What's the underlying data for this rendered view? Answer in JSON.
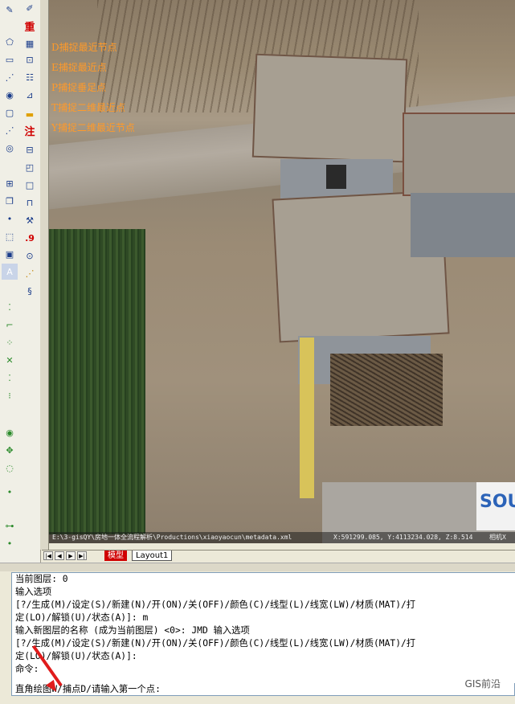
{
  "toolbar_left": {
    "icons": [
      "edit-icon",
      "polygon-icon",
      "rectangle-icon",
      "dots-icon",
      "circle-icon",
      "rounded-rect-icon",
      "dots-icon",
      "eye-icon",
      "grid-icon",
      "layers-icon",
      "dot-icon",
      "select-icon",
      "frame-icon"
    ],
    "label_a": "A"
  },
  "toolbar_right": {
    "btn_chong": "重",
    "btn_zhu": "注",
    "btn_9": ".9"
  },
  "canvas": {
    "snap_labels": [
      "D捕捉最近节点",
      "E捕捉最近点",
      "P捕捉垂足点",
      "T捕捉二维最近点",
      "Y捕捉二维最近节点"
    ],
    "logo_text": "SOUT",
    "path_text": "E:\\3-gisQY\\房地一体全流程解析\\Productions\\xiaoyaocun\\metadata.xml",
    "coord_text": "X:591299.085, Y:4113234.028, Z:8.514",
    "mark_text": "相机X"
  },
  "layout_tabs": {
    "model": "模型",
    "layout1": "Layout1"
  },
  "command": {
    "lines": [
      "当前图层:  0",
      "输入选项",
      "[?/生成(M)/设定(S)/新建(N)/开(ON)/关(OFF)/颜色(C)/线型(L)/线宽(LW)/材质(MAT)/打",
      "定(LO)/解锁(U)/状态(A)]: m",
      "输入新图层的名称 (成为当前图层) <0>: JMD 输入选项",
      "[?/生成(M)/设定(S)/新建(N)/开(ON)/关(OFF)/颜色(C)/线型(L)/线宽(LW)/材质(MAT)/打",
      "定(LO)/解锁(U)/状态(A)]:",
      "命令:"
    ],
    "prompt": "直角绘图W/捕点D/请输入第一个点:"
  },
  "watermark": "GIS前沿",
  "colors": {
    "accent_red": "#e01b1b",
    "snap_label": "#ff9a2a"
  }
}
